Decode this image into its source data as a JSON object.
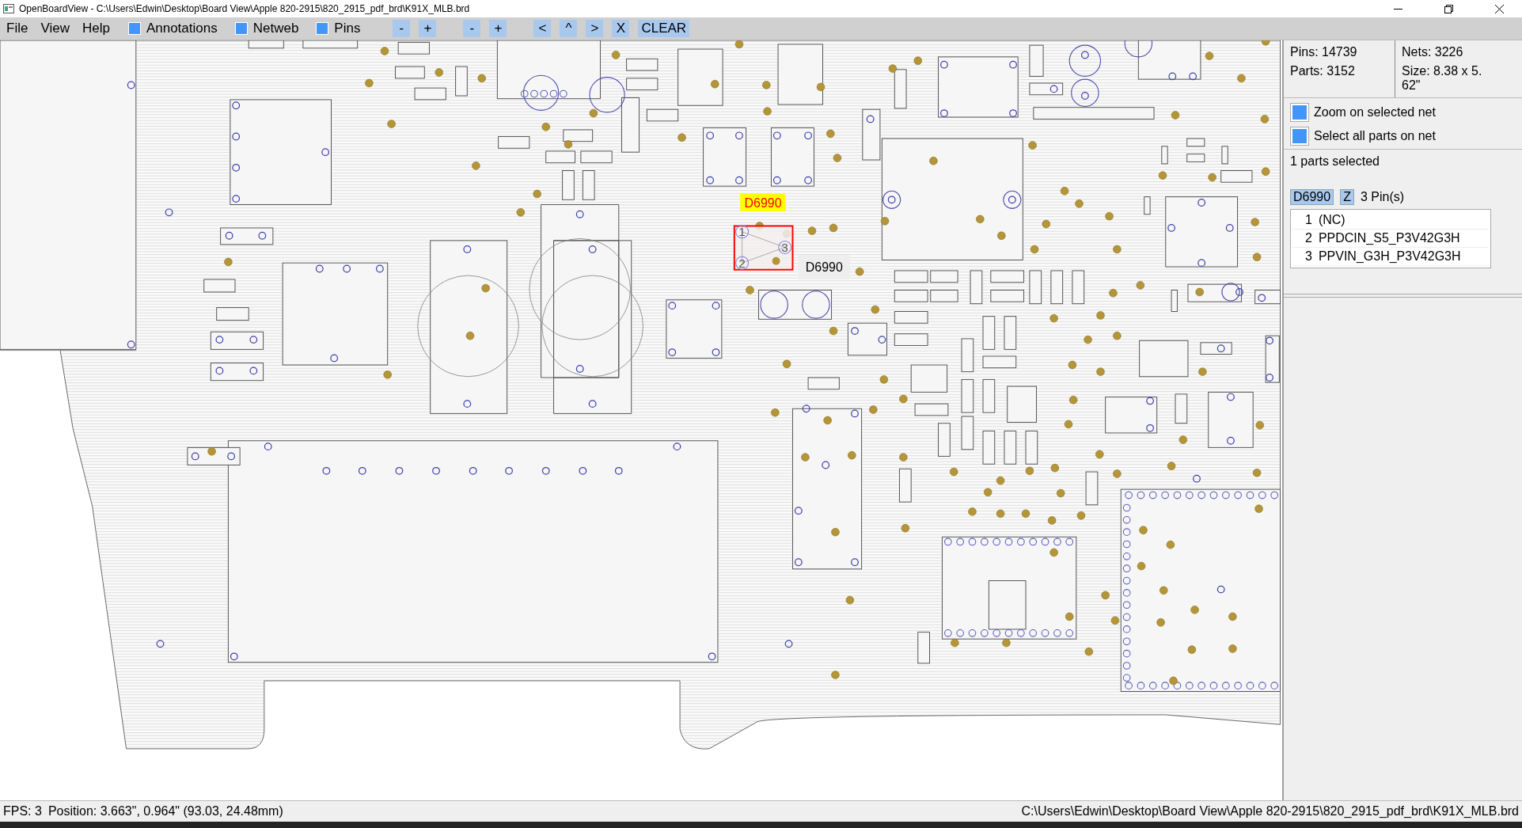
{
  "window": {
    "title": "OpenBoardView - C:\\Users\\Edwin\\Desktop\\Board View\\Apple 820-2915\\820_2915_pdf_brd\\K91X_MLB.brd"
  },
  "menu": [
    "File",
    "View",
    "Help"
  ],
  "toggles": [
    {
      "label": "Annotations",
      "checked": true
    },
    {
      "label": "Netweb",
      "checked": true
    },
    {
      "label": "Pins",
      "checked": true
    }
  ],
  "toolbar_groups": [
    [
      "-",
      "+"
    ],
    [
      "-",
      "+"
    ],
    [
      "<",
      "^",
      ">",
      "X",
      "CLEAR"
    ]
  ],
  "board": {
    "selected_part": {
      "label": "D6990",
      "pins": [
        "1",
        "2",
        "3"
      ]
    },
    "hover_label": "D6990"
  },
  "info": {
    "pins": "Pins: 14739",
    "parts": "Parts: 3152",
    "nets": "Nets: 3226",
    "size_lines": [
      "Size: 8.38 x 5.",
      "62\""
    ]
  },
  "options": [
    {
      "label": "Zoom on selected net",
      "checked": true
    },
    {
      "label": "Select all parts on net",
      "checked": true
    }
  ],
  "selection_summary": "1 parts selected",
  "part": {
    "name": "D6990",
    "zoom_button": "Z",
    "pin_count": "3 Pin(s)",
    "pins": [
      {
        "number": "1",
        "net": "(NC)"
      },
      {
        "number": "2",
        "net": "PPDCIN_S5_P3V42G3H"
      },
      {
        "number": "3",
        "net": "PPVIN_G3H_P3V42G3H"
      }
    ]
  },
  "status_bar": {
    "fps": "FPS: 3",
    "position": "Position: 3.663\", 0.964\" (93.03, 24.48mm)",
    "file_path": "C:\\Users\\Edwin\\Desktop\\Board View\\Apple 820-2915\\820_2915_pdf_brd\\K91X_MLB.brd"
  }
}
